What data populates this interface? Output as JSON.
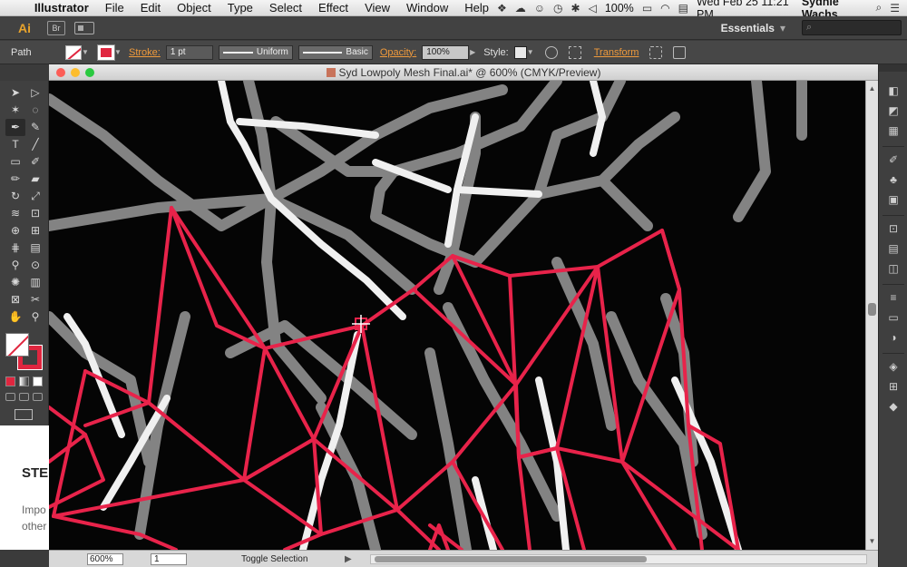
{
  "menubar": {
    "app_name": "Illustrator",
    "items": [
      "File",
      "Edit",
      "Object",
      "Type",
      "Select",
      "Effect",
      "View",
      "Window",
      "Help"
    ],
    "battery": "100%",
    "datetime": "Wed Feb 25  11:21 PM",
    "user": "Sydnie Wachs"
  },
  "appbar": {
    "logo": "Ai",
    "bridge": "Br",
    "workspace": "Essentials",
    "workspace_arrow": "▾"
  },
  "control": {
    "selection_type": "Path",
    "stroke_label": "Stroke:",
    "stroke_weight": "1 pt",
    "profile": "Uniform",
    "brush": "Basic",
    "opacity_label": "Opacity:",
    "opacity_value": "100%",
    "style_label": "Style:",
    "transform_label": "Transform"
  },
  "document": {
    "title": "Syd Lowpoly Mesh Final.ai* @ 600% (CMYK/Preview)"
  },
  "status": {
    "zoom": "600%",
    "artboard": "1",
    "tool_status": "Toggle Selection"
  },
  "background_page": {
    "heading": "STE",
    "text_line1": "Impo",
    "text_line2": "other"
  },
  "colors": {
    "accent_mesh": "#e8234a",
    "canvas_bg": "#050505",
    "menu_bg": "#e8e8e8"
  }
}
